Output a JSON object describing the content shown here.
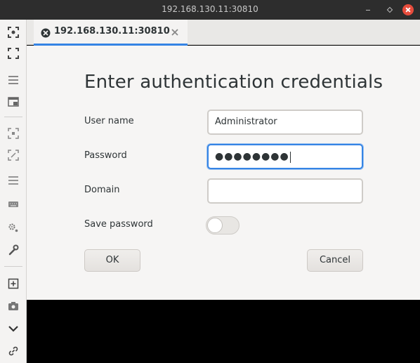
{
  "window": {
    "title": "192.168.130.11:30810"
  },
  "tab": {
    "label": "192.168.130.11:30810"
  },
  "dialog": {
    "heading": "Enter authentication credentials",
    "username_label": "User name",
    "username_value": "Administrator",
    "password_label": "Password",
    "password_value": "●●●●●●●●",
    "domain_label": "Domain",
    "domain_value": "",
    "save_password_label": "Save password",
    "save_password_enabled": false,
    "ok_label": "OK",
    "cancel_label": "Cancel"
  },
  "sidebar": {
    "icons": [
      "fit-window-icon",
      "fullscreen-icon",
      "menu-icon",
      "window-mode-icon",
      "scale-icon",
      "resize-icon",
      "toolbar-menu-icon",
      "keyboard-icon",
      "preferences-icon",
      "tools-icon",
      "new-connection-icon",
      "screenshot-icon",
      "chevron-down-icon",
      "disconnect-icon"
    ]
  },
  "colors": {
    "accent": "#3584e4",
    "titlebar": "#2d2d2d",
    "close": "#e74c3c"
  }
}
